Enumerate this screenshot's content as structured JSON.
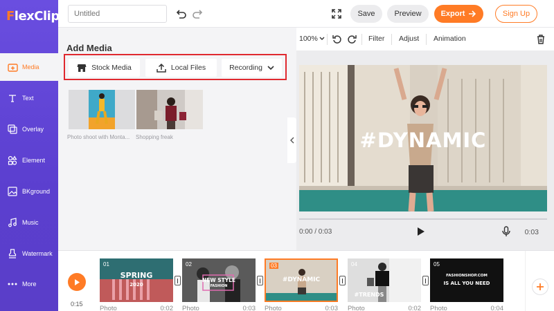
{
  "app": {
    "logo_text": "FlexClip",
    "accent": "#ff7b25",
    "sidebar_color": "#6a4ee0",
    "highlight_box": "#e0292f"
  },
  "sidebar": {
    "items": [
      {
        "label": "Media",
        "icon": "media-icon",
        "active": true
      },
      {
        "label": "Text",
        "icon": "text-icon"
      },
      {
        "label": "Overlay",
        "icon": "overlay-icon"
      },
      {
        "label": "Element",
        "icon": "element-icon"
      },
      {
        "label": "BKground",
        "icon": "background-icon"
      },
      {
        "label": "Music",
        "icon": "music-icon"
      },
      {
        "label": "Watermark",
        "icon": "watermark-icon"
      },
      {
        "label": "More",
        "icon": "more-icon"
      }
    ]
  },
  "topbar": {
    "title_placeholder": "Untitled",
    "save_label": "Save",
    "preview_label": "Preview",
    "export_label": "Export",
    "signup_label": "Sign Up"
  },
  "media_panel": {
    "title": "Add Media",
    "tabs": [
      {
        "label": "Stock Media"
      },
      {
        "label": "Local Files"
      },
      {
        "label": "Recording"
      }
    ],
    "items": [
      {
        "caption": "Photo shoot with Monta..."
      },
      {
        "caption": "Shopping freak"
      }
    ]
  },
  "preview": {
    "zoom": "100%",
    "tools": [
      "Filter",
      "Adjust",
      "Animation"
    ],
    "overlay_text": "#DYNAMIC",
    "current_time": "0:00 / 0:03",
    "duration": "0:03"
  },
  "timeline": {
    "total": "0:15",
    "clips": [
      {
        "num": "01",
        "type": "Photo",
        "duration": "0:02",
        "text": "SPRING",
        "sub": "2020"
      },
      {
        "num": "02",
        "type": "Photo",
        "duration": "0:03",
        "text": "NEW STYLE",
        "sub": "FASHION"
      },
      {
        "num": "03",
        "type": "Photo",
        "duration": "0:03",
        "text": "#DYNAMIC",
        "selected": true
      },
      {
        "num": "04",
        "type": "Photo",
        "duration": "0:02",
        "text": "#TRENDS"
      },
      {
        "num": "05",
        "type": "Photo",
        "duration": "0:04",
        "text": "FASHIONSHOP.COM",
        "sub": "IS ALL YOU NEED"
      }
    ]
  }
}
